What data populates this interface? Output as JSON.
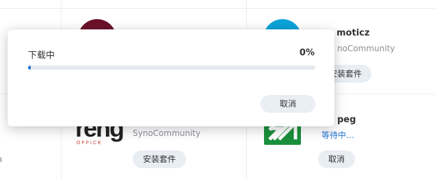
{
  "dialog": {
    "label": "下载中",
    "percent_text": "0%",
    "progress_fraction": 0.01,
    "cancel_label": "取消",
    "accent": "#1f74d1"
  },
  "packages": [
    {
      "title_partial": "moticz",
      "publisher_partial": "noCommunity",
      "button_partial": "安装套件",
      "icon": "domoticz-icon"
    },
    {
      "publisher": "SynoCommunity",
      "button": "安装套件",
      "icon": "feng-office-logo",
      "logo_word": "reng",
      "logo_sub": "OFFICE"
    },
    {
      "title_partial": "peg",
      "status": "等待中…",
      "button": "取消",
      "icon": "ffmpeg-icon"
    }
  ],
  "edge_fragment": "a"
}
